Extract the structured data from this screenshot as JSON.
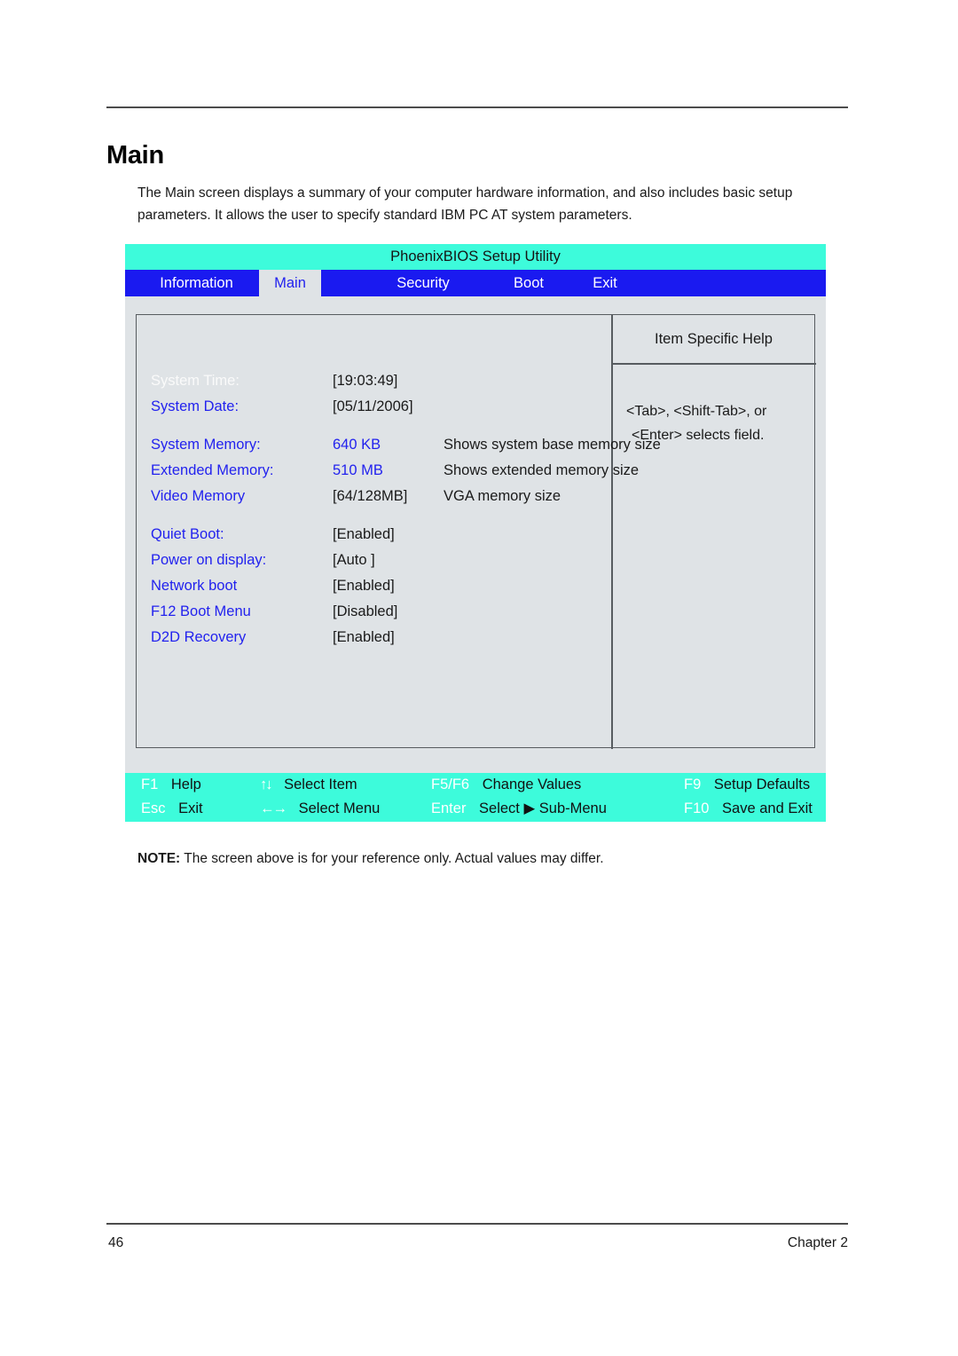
{
  "document": {
    "heading": "Main",
    "intro": "The Main screen displays a summary of your computer hardware information, and also includes basic setup parameters. It allows the user to specify standard IBM PC AT system parameters.",
    "note_label": "NOTE:",
    "note_text": " The screen above is for your reference only. Actual values may differ.",
    "folio_page": "46",
    "folio_chapter": "Chapter 2"
  },
  "bios": {
    "title": "PhoenixBIOS Setup Utility",
    "colors": {
      "title_bar": "#3DFBDB",
      "tab_bar": "#1A1AF0",
      "panel_bg": "#DFE3E6",
      "label_blue": "#2222EE",
      "selected_label": "#FAFAFA",
      "border": "#575C60"
    },
    "tabs": [
      {
        "label": "Information",
        "active": false
      },
      {
        "label": "Main",
        "active": true
      },
      {
        "label": "Security",
        "active": false
      },
      {
        "label": "Boot",
        "active": false
      },
      {
        "label": "Exit",
        "active": false
      }
    ],
    "help": {
      "title": "Item Specific Help",
      "line1": "<Tab>, <Shift-Tab>, or",
      "line2": "<Enter> selects field."
    },
    "settings": [
      {
        "label": "System Time:",
        "value": "[19:03:49]",
        "desc": "",
        "selected": true,
        "value_blue": false
      },
      {
        "label": "System Date:",
        "value": "[05/11/2006]",
        "desc": "",
        "selected": false,
        "value_blue": false
      },
      {
        "label": "System Memory:",
        "value": "640 KB",
        "desc": "Shows system base memory size",
        "selected": false,
        "value_blue": true
      },
      {
        "label": "Extended Memory:",
        "value": "510 MB",
        "desc": "Shows extended memory size",
        "selected": false,
        "value_blue": true
      },
      {
        "label": "Video Memory",
        "value": "[64/128MB]",
        "desc": "VGA memory size",
        "selected": false,
        "value_blue": false
      },
      {
        "label": "Quiet Boot:",
        "value": "[Enabled]",
        "desc": "",
        "selected": false,
        "value_blue": false
      },
      {
        "label": "Power on display:",
        "value": "[Auto ]",
        "desc": "",
        "selected": false,
        "value_blue": false
      },
      {
        "label": "Network boot",
        "value": "[Enabled]",
        "desc": "",
        "selected": false,
        "value_blue": false
      },
      {
        "label": "F12 Boot Menu",
        "value": "[Disabled]",
        "desc": "",
        "selected": false,
        "value_blue": false
      },
      {
        "label": "D2D Recovery",
        "value": "[Enabled]",
        "desc": "",
        "selected": false,
        "value_blue": false
      }
    ],
    "keybar": {
      "row1": {
        "f1_key": "F1",
        "f1_action": "Help",
        "updown_icon": "↑↓",
        "updown_action": "Select Item",
        "f5f6_key": "F5/F6",
        "f5f6_action": "Change Values",
        "f9_key": "F9",
        "f9_action": "Setup Defaults"
      },
      "row2": {
        "esc_key": "Esc",
        "esc_action": "Exit",
        "leftright_icon": "←→",
        "leftright_action": "Select Menu",
        "enter_key": "Enter",
        "enter_action": "Select",
        "submenu_icon": "▶",
        "submenu_action": "Sub-Menu",
        "f10_key": "F10",
        "f10_action": "Save and Exit"
      }
    }
  }
}
